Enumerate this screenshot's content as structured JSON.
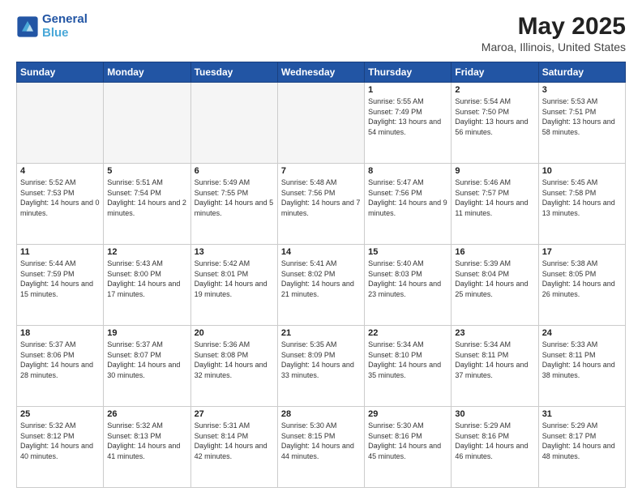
{
  "header": {
    "logo_line1": "General",
    "logo_line2": "Blue",
    "title": "May 2025",
    "subtitle": "Maroa, Illinois, United States"
  },
  "days_of_week": [
    "Sunday",
    "Monday",
    "Tuesday",
    "Wednesday",
    "Thursday",
    "Friday",
    "Saturday"
  ],
  "weeks": [
    [
      {
        "day": "",
        "empty": true
      },
      {
        "day": "",
        "empty": true
      },
      {
        "day": "",
        "empty": true
      },
      {
        "day": "",
        "empty": true
      },
      {
        "day": "1",
        "sunrise": "5:55 AM",
        "sunset": "7:49 PM",
        "daylight": "13 hours and 54 minutes."
      },
      {
        "day": "2",
        "sunrise": "5:54 AM",
        "sunset": "7:50 PM",
        "daylight": "13 hours and 56 minutes."
      },
      {
        "day": "3",
        "sunrise": "5:53 AM",
        "sunset": "7:51 PM",
        "daylight": "13 hours and 58 minutes."
      }
    ],
    [
      {
        "day": "4",
        "sunrise": "5:52 AM",
        "sunset": "7:53 PM",
        "daylight": "14 hours and 0 minutes."
      },
      {
        "day": "5",
        "sunrise": "5:51 AM",
        "sunset": "7:54 PM",
        "daylight": "14 hours and 2 minutes."
      },
      {
        "day": "6",
        "sunrise": "5:49 AM",
        "sunset": "7:55 PM",
        "daylight": "14 hours and 5 minutes."
      },
      {
        "day": "7",
        "sunrise": "5:48 AM",
        "sunset": "7:56 PM",
        "daylight": "14 hours and 7 minutes."
      },
      {
        "day": "8",
        "sunrise": "5:47 AM",
        "sunset": "7:56 PM",
        "daylight": "14 hours and 9 minutes."
      },
      {
        "day": "9",
        "sunrise": "5:46 AM",
        "sunset": "7:57 PM",
        "daylight": "14 hours and 11 minutes."
      },
      {
        "day": "10",
        "sunrise": "5:45 AM",
        "sunset": "7:58 PM",
        "daylight": "14 hours and 13 minutes."
      }
    ],
    [
      {
        "day": "11",
        "sunrise": "5:44 AM",
        "sunset": "7:59 PM",
        "daylight": "14 hours and 15 minutes."
      },
      {
        "day": "12",
        "sunrise": "5:43 AM",
        "sunset": "8:00 PM",
        "daylight": "14 hours and 17 minutes."
      },
      {
        "day": "13",
        "sunrise": "5:42 AM",
        "sunset": "8:01 PM",
        "daylight": "14 hours and 19 minutes."
      },
      {
        "day": "14",
        "sunrise": "5:41 AM",
        "sunset": "8:02 PM",
        "daylight": "14 hours and 21 minutes."
      },
      {
        "day": "15",
        "sunrise": "5:40 AM",
        "sunset": "8:03 PM",
        "daylight": "14 hours and 23 minutes."
      },
      {
        "day": "16",
        "sunrise": "5:39 AM",
        "sunset": "8:04 PM",
        "daylight": "14 hours and 25 minutes."
      },
      {
        "day": "17",
        "sunrise": "5:38 AM",
        "sunset": "8:05 PM",
        "daylight": "14 hours and 26 minutes."
      }
    ],
    [
      {
        "day": "18",
        "sunrise": "5:37 AM",
        "sunset": "8:06 PM",
        "daylight": "14 hours and 28 minutes."
      },
      {
        "day": "19",
        "sunrise": "5:37 AM",
        "sunset": "8:07 PM",
        "daylight": "14 hours and 30 minutes."
      },
      {
        "day": "20",
        "sunrise": "5:36 AM",
        "sunset": "8:08 PM",
        "daylight": "14 hours and 32 minutes."
      },
      {
        "day": "21",
        "sunrise": "5:35 AM",
        "sunset": "8:09 PM",
        "daylight": "14 hours and 33 minutes."
      },
      {
        "day": "22",
        "sunrise": "5:34 AM",
        "sunset": "8:10 PM",
        "daylight": "14 hours and 35 minutes."
      },
      {
        "day": "23",
        "sunrise": "5:34 AM",
        "sunset": "8:11 PM",
        "daylight": "14 hours and 37 minutes."
      },
      {
        "day": "24",
        "sunrise": "5:33 AM",
        "sunset": "8:11 PM",
        "daylight": "14 hours and 38 minutes."
      }
    ],
    [
      {
        "day": "25",
        "sunrise": "5:32 AM",
        "sunset": "8:12 PM",
        "daylight": "14 hours and 40 minutes."
      },
      {
        "day": "26",
        "sunrise": "5:32 AM",
        "sunset": "8:13 PM",
        "daylight": "14 hours and 41 minutes."
      },
      {
        "day": "27",
        "sunrise": "5:31 AM",
        "sunset": "8:14 PM",
        "daylight": "14 hours and 42 minutes."
      },
      {
        "day": "28",
        "sunrise": "5:30 AM",
        "sunset": "8:15 PM",
        "daylight": "14 hours and 44 minutes."
      },
      {
        "day": "29",
        "sunrise": "5:30 AM",
        "sunset": "8:16 PM",
        "daylight": "14 hours and 45 minutes."
      },
      {
        "day": "30",
        "sunrise": "5:29 AM",
        "sunset": "8:16 PM",
        "daylight": "14 hours and 46 minutes."
      },
      {
        "day": "31",
        "sunrise": "5:29 AM",
        "sunset": "8:17 PM",
        "daylight": "14 hours and 48 minutes."
      }
    ]
  ]
}
